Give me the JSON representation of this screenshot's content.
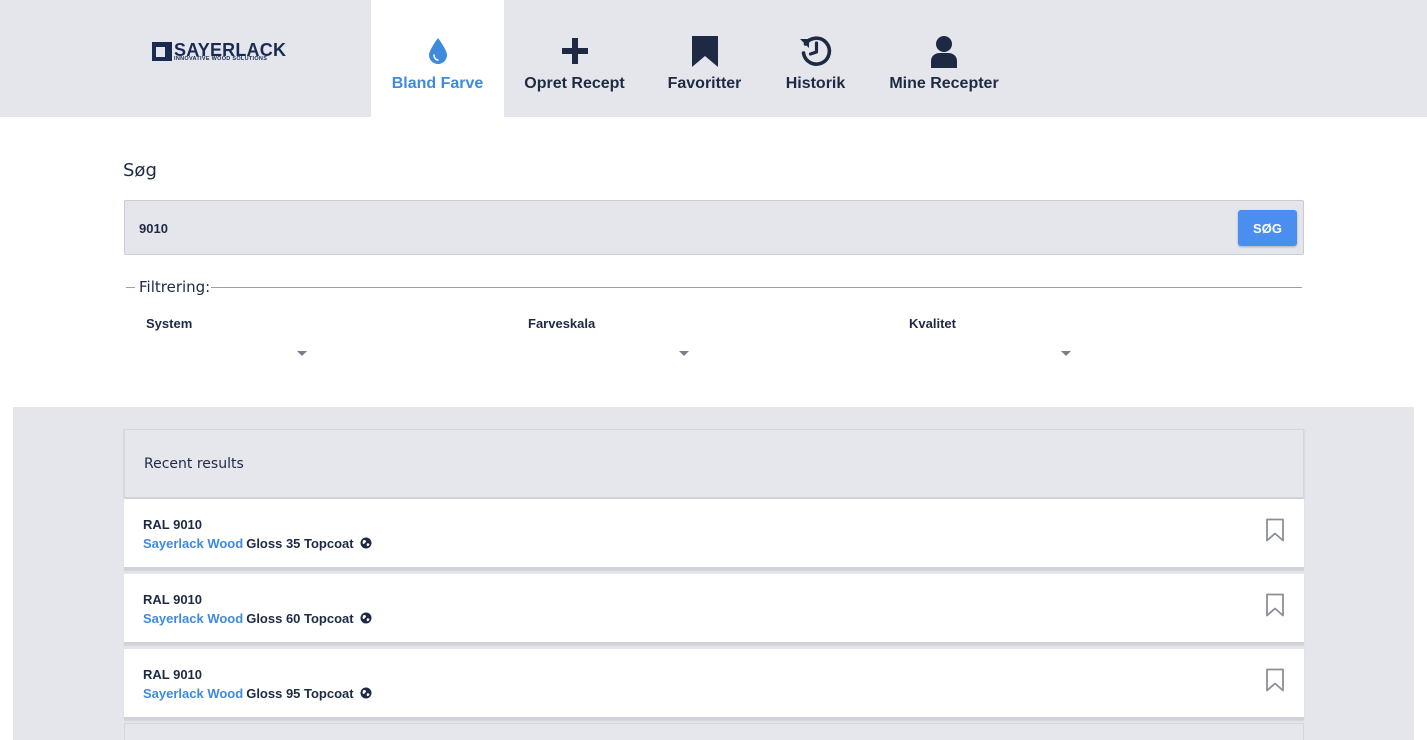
{
  "brand": {
    "name": "SAYERLACK",
    "tagline": "INNOVATIVE WOOD SOLUTIONS"
  },
  "nav": {
    "tabs": [
      {
        "label": "Bland Farve",
        "icon": "drop-icon",
        "active": true
      },
      {
        "label": "Opret Recept",
        "icon": "plus-icon",
        "active": false
      },
      {
        "label": "Favoritter",
        "icon": "bookmark-icon",
        "active": false
      },
      {
        "label": "Historik",
        "icon": "history-icon",
        "active": false
      },
      {
        "label": "Mine Recepter",
        "icon": "user-icon",
        "active": false
      }
    ]
  },
  "search": {
    "title": "Søg",
    "value": "9010",
    "button_label": "SØG"
  },
  "filter": {
    "legend": "Filtrering:",
    "fields": [
      {
        "label": "System",
        "value": ""
      },
      {
        "label": "Farveskala",
        "value": ""
      },
      {
        "label": "Kvalitet",
        "value": ""
      }
    ]
  },
  "results": {
    "title": "Recent results",
    "items": [
      {
        "code": "RAL 9010",
        "brand": "Sayerlack Wood",
        "product": "Gloss 35 Topcoat"
      },
      {
        "code": "RAL 9010",
        "brand": "Sayerlack Wood",
        "product": "Gloss 60 Topcoat"
      },
      {
        "code": "RAL 9010",
        "brand": "Sayerlack Wood",
        "product": "Gloss 95 Topcoat"
      }
    ]
  },
  "colors": {
    "accent": "#3e8bde",
    "navy": "#1e2a44",
    "header_bg": "#e4e6ec",
    "button": "#4a8ff0"
  }
}
